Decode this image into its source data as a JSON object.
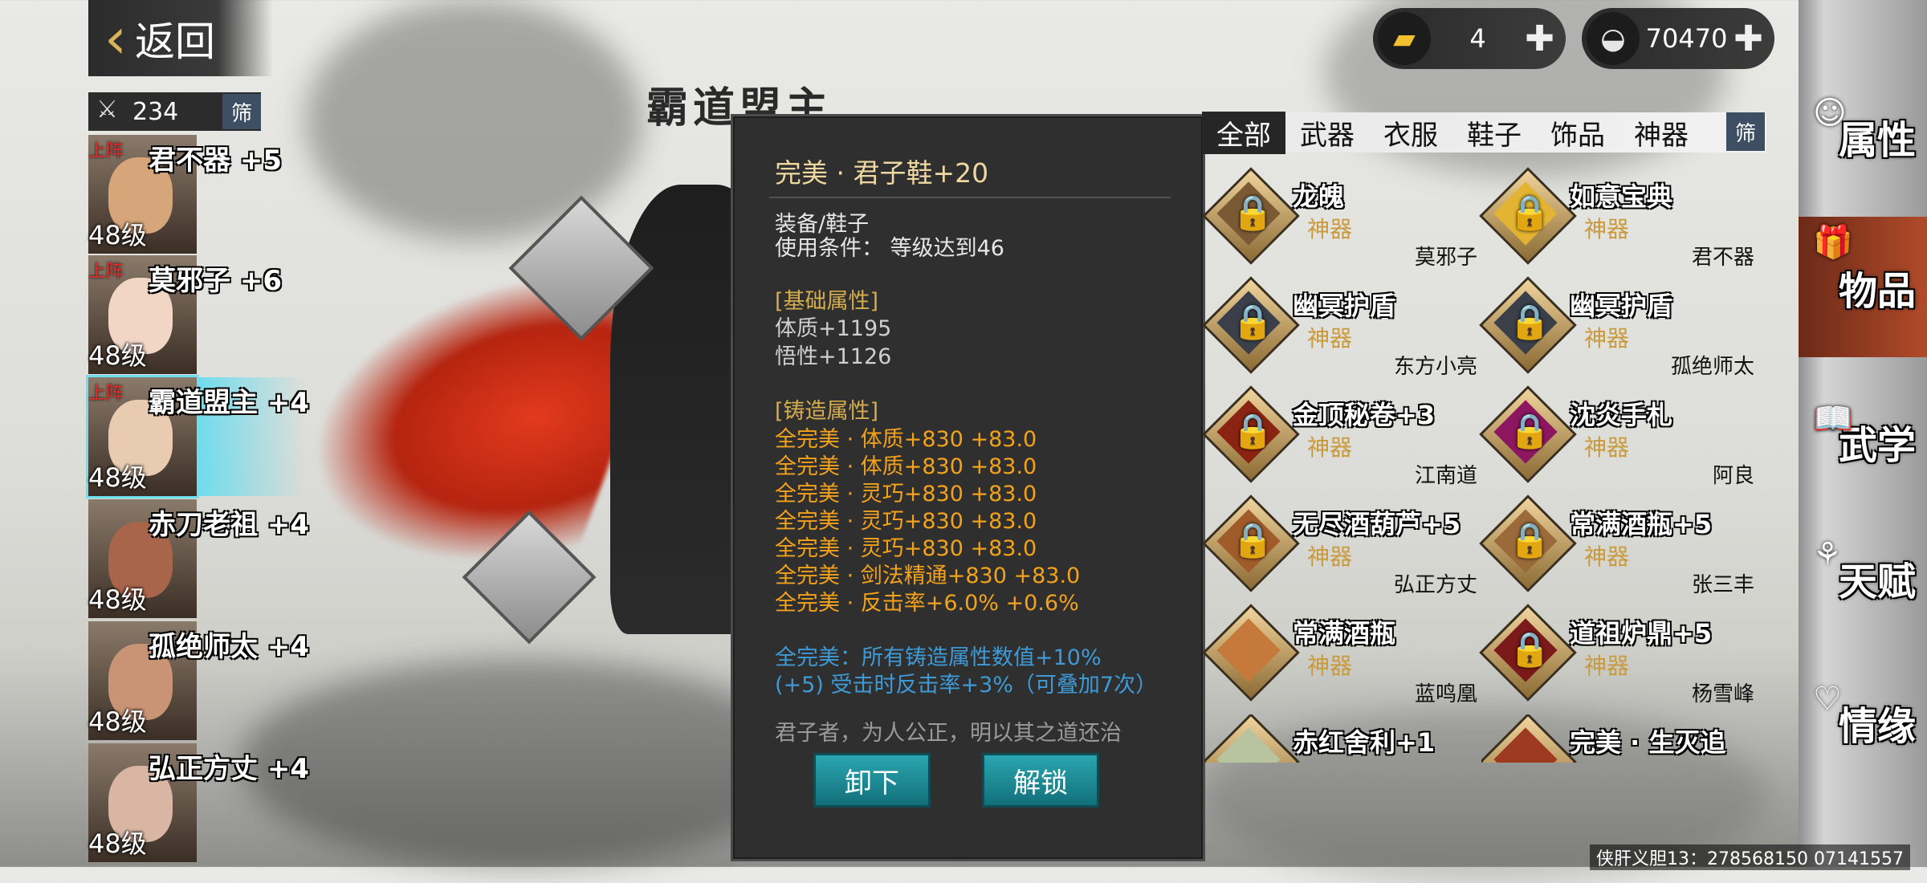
{
  "top": {
    "back_label": "返回",
    "gold_value": "4",
    "silver_value": "70470"
  },
  "hero_list": {
    "count": "234",
    "filter_label": "筛",
    "heroes": [
      {
        "tag": "上阵",
        "name": "君不器",
        "plus": "+5",
        "level": "48级"
      },
      {
        "tag": "上阵",
        "name": "莫邪子",
        "plus": "+6",
        "level": "48级"
      },
      {
        "tag": "上阵",
        "name": "霸道盟主",
        "plus": "+4",
        "level": "48级"
      },
      {
        "tag": "",
        "name": "赤刀老祖",
        "plus": "+4",
        "level": "48级"
      },
      {
        "tag": "",
        "name": "孤绝师太",
        "plus": "+4",
        "level": "48级"
      },
      {
        "tag": "",
        "name": "弘正方丈",
        "plus": "+4",
        "level": "48级"
      }
    ]
  },
  "character": {
    "title": "霸道盟主"
  },
  "popup": {
    "title": "完美 · 君子鞋+20",
    "equip_type": "装备/鞋子",
    "use_condition": "使用条件：  等级达到46",
    "base_header": "[基础属性]",
    "base_stats": [
      "体质+1195",
      "悟性+1126"
    ],
    "forge_header": "[铸造属性]",
    "forge_stats": [
      "全完美 · 体质+830  +83.0",
      "全完美 · 体质+830  +83.0",
      "全完美 · 灵巧+830  +83.0",
      "全完美 · 灵巧+830  +83.0",
      "全完美 · 灵巧+830  +83.0",
      "全完美 · 剑法精通+830  +83.0",
      "全完美 · 反击率+6.0%  +0.6%"
    ],
    "set_bonus_1": "全完美：所有铸造属性数值+10%",
    "set_bonus_2": "(+5) 受击时反击率+3%（可叠加7次）",
    "flavor": "君子者，为人公正，明以其之道还治",
    "unequip_label": "卸下",
    "unlock_label": "解锁"
  },
  "categories": {
    "tabs": [
      "全部",
      "武器",
      "衣服",
      "鞋子",
      "饰品",
      "神器"
    ],
    "active": "全部",
    "filter_label": "筛"
  },
  "items": [
    {
      "name": "龙魄",
      "type": "神器",
      "owner": "莫邪子",
      "icon": "dragon-soul-icon"
    },
    {
      "name": "如意宝典",
      "type": "神器",
      "owner": "君不器",
      "icon": "book-icon"
    },
    {
      "name": "幽冥护盾",
      "type": "神器",
      "owner": "东方小亮",
      "icon": "shield-icon"
    },
    {
      "name": "幽冥护盾",
      "type": "神器",
      "owner": "孤绝师太",
      "icon": "shield-icon"
    },
    {
      "name": "金顶秘卷+3",
      "type": "神器",
      "owner": "江南道",
      "icon": "scroll-icon"
    },
    {
      "name": "沈炎手札",
      "type": "神器",
      "owner": "阿良",
      "icon": "notebook-icon"
    },
    {
      "name": "无尽酒葫芦+5",
      "type": "神器",
      "owner": "弘正方丈",
      "icon": "gourd-icon"
    },
    {
      "name": "常满酒瓶+5",
      "type": "神器",
      "owner": "张三丰",
      "icon": "bottle-icon"
    },
    {
      "name": "常满酒瓶",
      "type": "神器",
      "owner": "蓝鸣凰",
      "icon": "gourd-icon"
    },
    {
      "name": "道祖炉鼎+5",
      "type": "神器",
      "owner": "杨雪峰",
      "icon": "cauldron-icon"
    },
    {
      "name": "赤红舍利+1",
      "type": "",
      "owner": "",
      "icon": "relic-icon"
    },
    {
      "name": "完美 · 生灭追",
      "type": "",
      "owner": "",
      "icon": "weapon-icon"
    }
  ],
  "side_nav": [
    "属性",
    "物品",
    "武学",
    "天赋",
    "情缘"
  ],
  "side_nav_active": "物品",
  "watermark": "侠肝义胆13：278568150  07141557",
  "colors": {
    "accent_orange": "#f3a21c",
    "accent_blue": "#3e9ad6",
    "button_teal": "#1c8e98",
    "nav_active": "#b14b29"
  }
}
